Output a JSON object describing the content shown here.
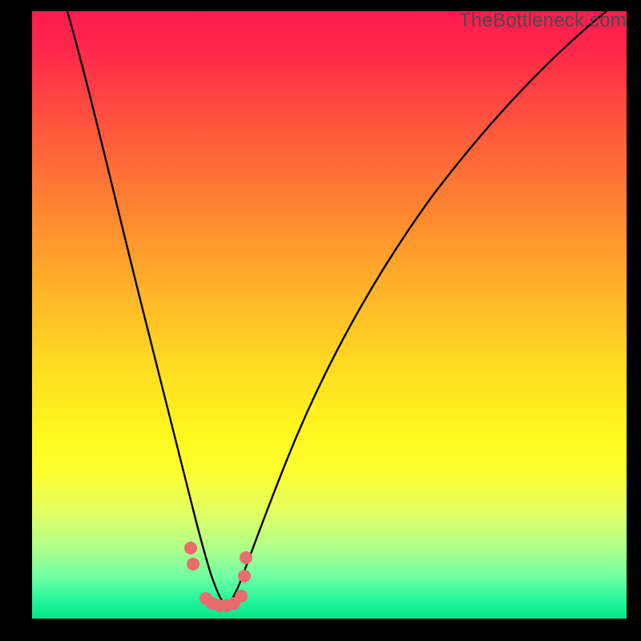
{
  "watermark": {
    "text": "TheBottleneck.com"
  },
  "chart_data": {
    "type": "line",
    "title": "",
    "xlabel": "",
    "ylabel": "",
    "xlim": [
      0,
      100
    ],
    "ylim": [
      0,
      100
    ],
    "series": [
      {
        "name": "bottleneck-curve",
        "x": [
          6,
          10,
          14,
          18,
          21,
          24,
          26,
          28,
          29.5,
          31,
          33,
          35,
          37,
          40,
          45,
          50,
          56,
          63,
          72,
          82,
          93,
          100
        ],
        "values": [
          100,
          84,
          68,
          52,
          38,
          25,
          15,
          7,
          3,
          1.5,
          1.5,
          3,
          7,
          13,
          24,
          34,
          44,
          54,
          64,
          73,
          81,
          86
        ]
      }
    ],
    "markers": {
      "name": "highlight-dots",
      "color": "#e96d6d",
      "x": [
        27,
        27.3,
        29.5,
        30.5,
        31.8,
        33,
        34.3,
        35.5,
        36,
        36.3
      ],
      "values": [
        11,
        8.5,
        2.8,
        2,
        1.7,
        1.7,
        2,
        3.2,
        6.5,
        9.5
      ]
    },
    "gradient_stops": [
      {
        "pos": 0,
        "color": "#ff1a50"
      },
      {
        "pos": 50,
        "color": "#ffba28"
      },
      {
        "pos": 75,
        "color": "#fff81f"
      },
      {
        "pos": 100,
        "color": "#00e686"
      }
    ]
  }
}
